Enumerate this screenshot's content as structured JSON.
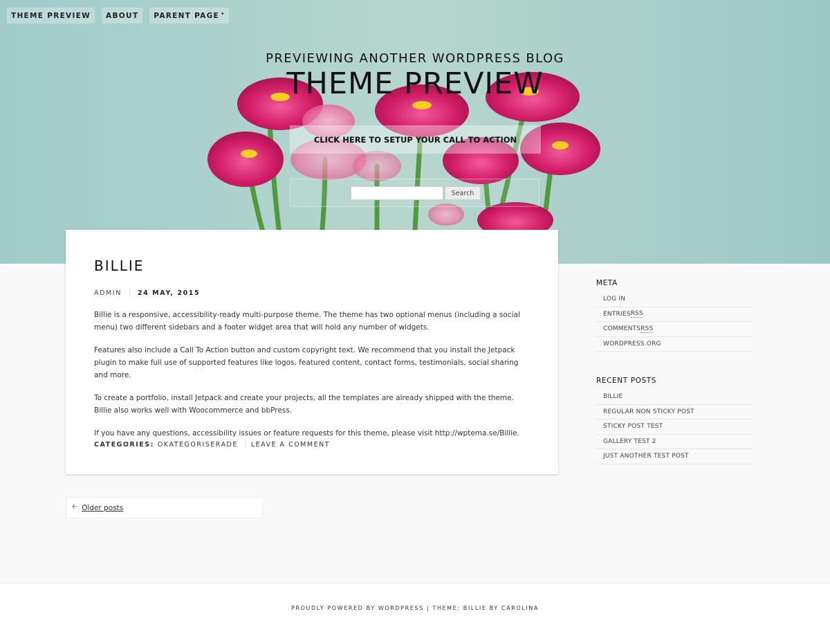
{
  "nav": {
    "items": [
      {
        "label": "THEME PREVIEW"
      },
      {
        "label": "ABOUT"
      },
      {
        "label": "PARENT PAGE",
        "caret": "▾"
      }
    ]
  },
  "header": {
    "description": "PREVIEWING ANOTHER WORDPRESS BLOG",
    "title": "THEME PREVIEW",
    "cta_label": "CLICK HERE TO SETUP YOUR CALL TO ACTION",
    "background_color": "#9dc8c6"
  },
  "search": {
    "input_value": "",
    "button_label": "Search"
  },
  "post": {
    "title": "BILLIE",
    "author": "ADMIN",
    "date": "24 MAY, 2015",
    "paragraphs": [
      "Billie is a responsive, accessibility-ready multi-purpose theme. The theme has two optional menus (including a social menu) two different sidebars and a footer widget area that will hold any number of widgets.",
      "Features also include a Call To Action button and custom copyright text. We recommend that you install the Jetpack plugin to make full use of supported features like logos, featured content, contact forms, testimonials, social sharing and more.",
      "To create a portfolio, install Jetpack and create your projects, all the templates are already shipped with the theme. Billie also works well with Woocommerce and bbPress.",
      "If you have any questions, accessibility issues or feature requests for this theme, please visit http://wptema.se/Billie."
    ],
    "categories_label": "CATEGORIES:",
    "category": "OKATEGORISERADE",
    "comment_link": "LEAVE A COMMENT"
  },
  "pagination": {
    "older_label": "Older posts",
    "arrow": "🡐"
  },
  "sidebar": {
    "meta": {
      "title": "META",
      "items": [
        {
          "label": "LOG IN"
        },
        {
          "pre": "ENTRIES ",
          "abbr": "RSS"
        },
        {
          "pre": "COMMENTS ",
          "abbr": "RSS"
        },
        {
          "label": "WORDPRESS.ORG"
        }
      ]
    },
    "recent": {
      "title": "RECENT POSTS",
      "items": [
        {
          "label": "BILLIE"
        },
        {
          "label": "REGULAR NON STICKY POST"
        },
        {
          "label": "STICKY POST TEST"
        },
        {
          "label": "GALLERY TEST 2"
        },
        {
          "label": "JUST ANOTHER TEST POST"
        }
      ]
    }
  },
  "footer": {
    "powered": "PROUDLY POWERED BY WORDPRESS",
    "separator": " | ",
    "theme_prefix": "THEME: ",
    "theme_name": "BILLIE",
    "by": " BY ",
    "author": "CAROLINA"
  }
}
